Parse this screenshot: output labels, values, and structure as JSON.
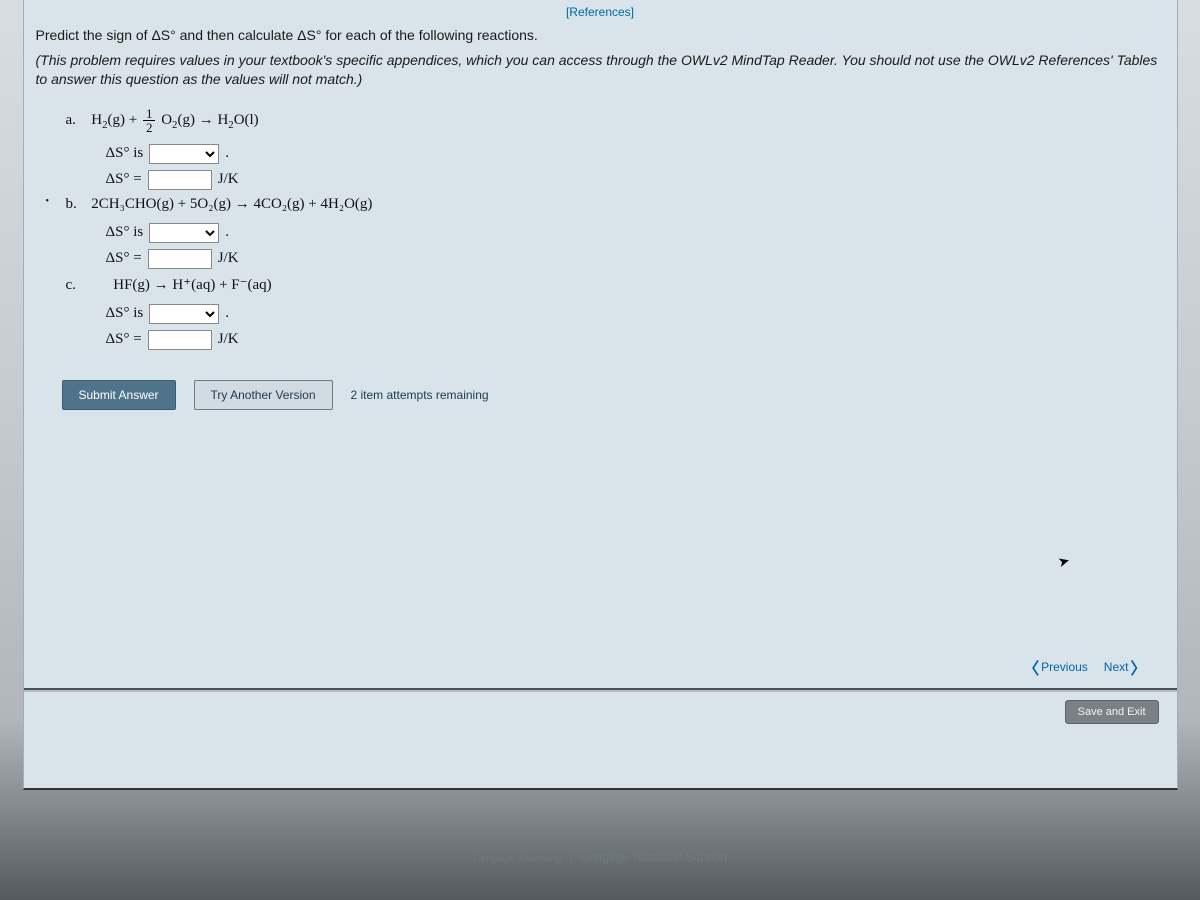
{
  "refs_link": "[References]",
  "intro": "Predict the sign of ΔS° and then calculate ΔS° for each of the following reactions.",
  "note": "(This problem requires values in your textbook's specific appendices, which you can access through the OWLv2 MindTap Reader. You should not use the OWLv2 References' Tables to answer this question as the values will not match.)",
  "deltaS_is": "ΔS° is",
  "deltaS_eq": "ΔS° =",
  "unit": "J/K",
  "period": ".",
  "parts": {
    "a": {
      "label": "a.",
      "eq_l1": "H",
      "eq_l1_sub": "2",
      "eq_l1_state": "(g) +",
      "frac_num": "1",
      "frac_den": "2",
      "eq_l2": "O",
      "eq_l2_sub": "2",
      "eq_l2_state": "(g) → H",
      "eq_l3_sub": "2",
      "eq_l3": "O(l)"
    },
    "b": {
      "label": "b.",
      "eq": "2CH₃CHO(g) + 5O₂(g) → 4CO₂(g) + 4H₂O(g)"
    },
    "c": {
      "label": "c.",
      "eq": "HF(g) → H⁺(aq) + F⁻(aq)"
    }
  },
  "buttons": {
    "submit": "Submit Answer",
    "try_another": "Try Another Version"
  },
  "attempts": "2 item attempts remaining",
  "nav": {
    "prev": "Previous",
    "next": "Next"
  },
  "save_exit": "Save and Exit",
  "footer": {
    "left": "Cengage Learning",
    "sep": "|",
    "right": "Cengage Technical Support"
  },
  "inputs": {
    "a_sign": "",
    "a_val": "",
    "b_sign": "",
    "b_val": "",
    "c_sign": "",
    "c_val": ""
  }
}
